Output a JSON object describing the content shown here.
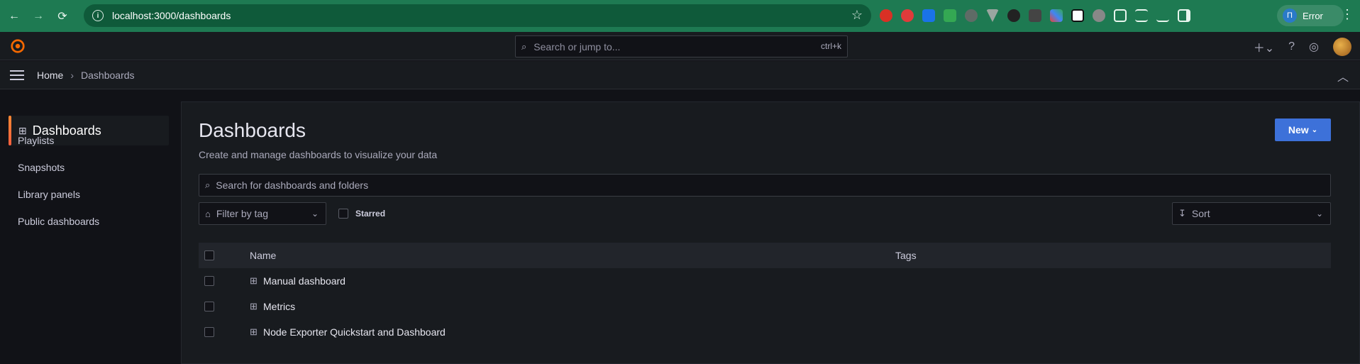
{
  "browser": {
    "url": "localhost:3000/dashboards",
    "profile_label": "Error",
    "profile_initial": "П",
    "extensions": [
      "adblock-red",
      "abp",
      "translate",
      "green",
      "eye",
      "vue",
      "vp",
      "save",
      "multicolor",
      "notion",
      "circle",
      "puzzle",
      "reading-list",
      "download",
      "sidepanel"
    ]
  },
  "topbar": {
    "search_placeholder": "Search or jump to...",
    "shortcut": "ctrl+k"
  },
  "breadcrumb": {
    "home": "Home",
    "separator": "›",
    "current": "Dashboards"
  },
  "sidenav": {
    "active": "Dashboards",
    "items": [
      "Playlists",
      "Snapshots",
      "Library panels",
      "Public dashboards"
    ]
  },
  "page": {
    "title": "Dashboards",
    "subtitle": "Create and manage dashboards to visualize your data",
    "new_button": "New",
    "search_placeholder": "Search for dashboards and folders",
    "filter_placeholder": "Filter by tag",
    "starred_label": "Starred",
    "sort_label": "Sort"
  },
  "table": {
    "columns": [
      "Name",
      "Tags"
    ],
    "rows": [
      {
        "name": "Manual dashboard"
      },
      {
        "name": "Metrics"
      },
      {
        "name": "Node Exporter Quickstart and Dashboard"
      }
    ]
  },
  "colors": {
    "chrome": "#1e7a52",
    "accent": "#3d71d9",
    "active_bar": "#ff8833"
  }
}
